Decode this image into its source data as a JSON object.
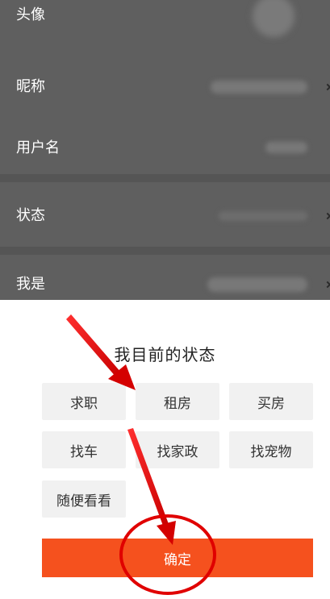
{
  "profile": {
    "rows": [
      {
        "label": "头像"
      },
      {
        "label": "昵称"
      },
      {
        "label": "用户名"
      },
      {
        "label": "状态"
      },
      {
        "label": "我是"
      }
    ]
  },
  "status_sheet": {
    "title": "我目前的状态",
    "options": [
      "求职",
      "租房",
      "买房",
      "找车",
      "找家政",
      "找宠物",
      "随便看看"
    ],
    "confirm_label": "确定"
  },
  "colors": {
    "confirm_bg": "#f5511e",
    "annotation_red": "#e00000"
  },
  "icons": {
    "row_chevron": "chevron-right-icon",
    "annotation_arrow": "red-arrow-annotation"
  }
}
